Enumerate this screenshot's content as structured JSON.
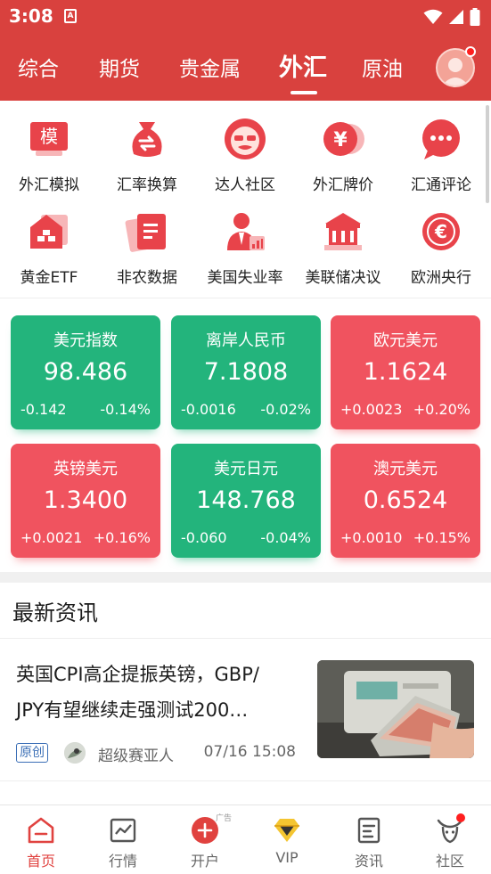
{
  "status_bar": {
    "time": "3:08",
    "app_icon_letter": "A"
  },
  "tabs": [
    {
      "label": "综合",
      "active": false
    },
    {
      "label": "期货",
      "active": false
    },
    {
      "label": "贵金属",
      "active": false
    },
    {
      "label": "外汇",
      "active": true
    },
    {
      "label": "原油",
      "active": false
    }
  ],
  "grid": {
    "row1": [
      {
        "label": "外汇模拟",
        "icon": "simulation-icon",
        "icon_text": "模"
      },
      {
        "label": "汇率换算",
        "icon": "money-bag-exchange-icon"
      },
      {
        "label": "达人社区",
        "icon": "expert-community-icon"
      },
      {
        "label": "外汇牌价",
        "icon": "yen-coin-icon",
        "icon_text": "¥"
      },
      {
        "label": "汇通评论",
        "icon": "comment-bubble-icon"
      }
    ],
    "row2": [
      {
        "label": "黄金ETF",
        "icon": "gold-etf-icon"
      },
      {
        "label": "非农数据",
        "icon": "nonfarm-data-icon"
      },
      {
        "label": "美国失业率",
        "icon": "unemployment-icon"
      },
      {
        "label": "美联储决议",
        "icon": "bank-icon"
      },
      {
        "label": "欧洲央行",
        "icon": "euro-coin-icon",
        "icon_text": "€"
      }
    ]
  },
  "cards": [
    {
      "name": "美元指数",
      "price": "98.486",
      "change": "-0.142",
      "percent": "-0.14%",
      "trend": "down",
      "color": "#23b47c"
    },
    {
      "name": "离岸人民币",
      "price": "7.1808",
      "change": "-0.0016",
      "percent": "-0.02%",
      "trend": "down",
      "color": "#23b47c"
    },
    {
      "name": "欧元美元",
      "price": "1.1624",
      "change": "+0.0023",
      "percent": "+0.20%",
      "trend": "up",
      "color": "#f0535f"
    },
    {
      "name": "英镑美元",
      "price": "1.3400",
      "change": "+0.0021",
      "percent": "+0.16%",
      "trend": "up",
      "color": "#f0535f"
    },
    {
      "name": "美元日元",
      "price": "148.768",
      "change": "-0.060",
      "percent": "-0.04%",
      "trend": "down",
      "color": "#23b47c"
    },
    {
      "name": "澳元美元",
      "price": "0.6524",
      "change": "+0.0010",
      "percent": "+0.15%",
      "trend": "up",
      "color": "#f0535f"
    }
  ],
  "news": {
    "section_title": "最新资讯",
    "items": [
      {
        "headline_line1": "英国CPI高企提振英镑，GBP/",
        "headline_line2": "JPY有望继续走强测试200…",
        "badge": "原创",
        "author": "超级赛亚人",
        "time": "07/16 15:08"
      }
    ]
  },
  "bottom_nav": [
    {
      "label": "首页",
      "icon": "home-icon",
      "active": true
    },
    {
      "label": "行情",
      "icon": "chart-icon",
      "active": false
    },
    {
      "label": "开户",
      "icon": "plus-circle-icon",
      "active": false
    },
    {
      "label": "VIP",
      "icon": "vip-diamond-icon",
      "active": false
    },
    {
      "label": "资讯",
      "icon": "news-doc-icon",
      "active": false
    },
    {
      "label": "社区",
      "icon": "community-icon",
      "active": false
    }
  ],
  "bottom_nav_ad_tag": "广告",
  "colors": {
    "brand_red": "#d9413e",
    "up_red": "#f0535f",
    "down_green": "#23b47c",
    "active_nav": "#e0423f"
  }
}
